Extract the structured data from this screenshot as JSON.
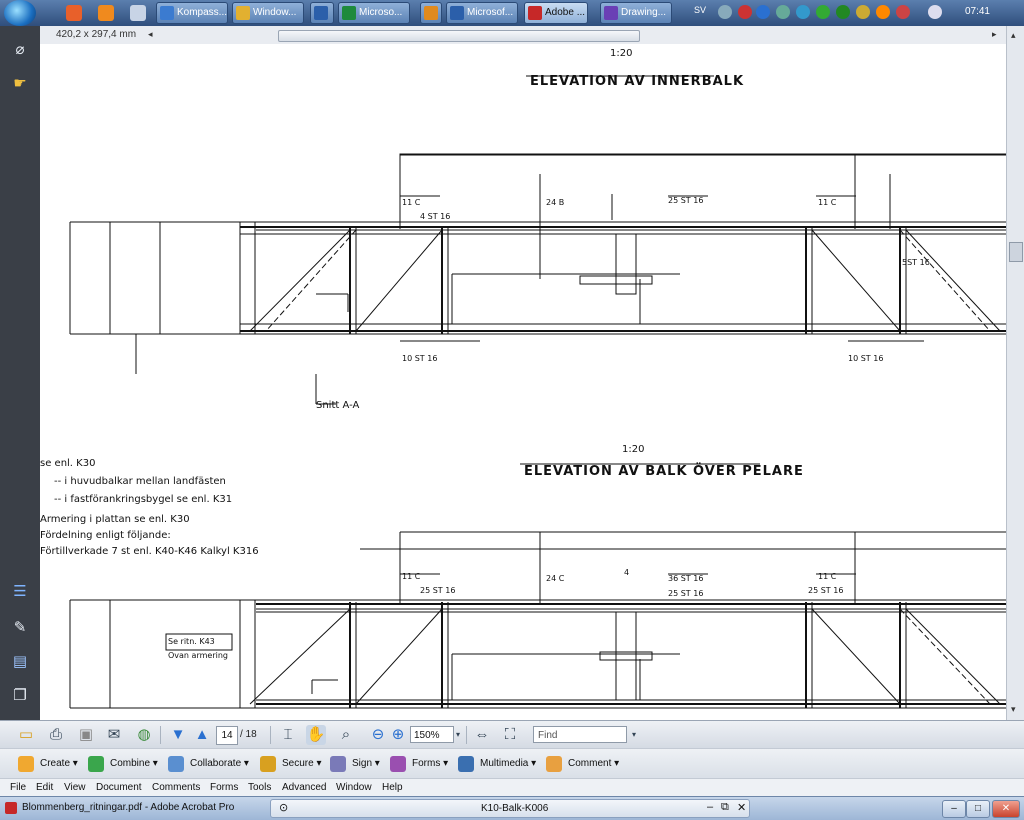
{
  "taskbar": {
    "tasks": [
      {
        "label": "Kompass...",
        "color": "#3b7bd0",
        "active": false
      },
      {
        "label": "Window...",
        "color": "#e2b030",
        "active": false
      },
      {
        "label": "",
        "color": "#2b5faa",
        "active": false
      },
      {
        "label": "Microso...",
        "color": "#1e8a3c",
        "active": false
      },
      {
        "label": "",
        "color": "#e08a1e",
        "active": false
      },
      {
        "label": "Microsof...",
        "color": "#2b5faa",
        "active": false
      },
      {
        "label": "Adobe ...",
        "color": "#c62828",
        "active": true
      },
      {
        "label": "Drawing...",
        "color": "#6a3fb5",
        "active": false
      }
    ],
    "language": "SV",
    "clock": "07:41"
  },
  "document": {
    "page_size": "420,2 x 297,4 mm",
    "title_top": "ELEVATION AV INNERBALK",
    "scale_top": "1:20",
    "title_bottom": "ELEVATION AV BALK ÖVER PELARE",
    "scale_bottom": "1:20",
    "label_section": "Snitt A-A",
    "labels": [
      "25 ST 16",
      "10 ST 16",
      "10 ST 16",
      "11 C",
      "11 C",
      "24 B",
      "36 ST 16",
      "25 ST 16",
      "24 C",
      "4 ST 16",
      "5ST 16",
      "11 C",
      "11 C",
      "25 ST 16",
      "25 ST 16",
      "4"
    ],
    "notes": [
      "Förtillverkade 7 st enl. K40-K46 Kalkyl K316",
      "Fördelning enligt följande:",
      "Armering i plattan se enl. K30",
      "-- i fastförankringsbygel se enl. K31",
      "-- i huvudbalkar mellan landfästen",
      "se enl. K30"
    ],
    "box_note_1": "Se ritn. K43",
    "box_note_2": "Ovan armering"
  },
  "toolbar1": {
    "page_current": "14",
    "page_total": "/ 18",
    "zoom": "150%",
    "find_placeholder": "Find"
  },
  "toolbar2": {
    "tools": [
      {
        "label": "Create",
        "color": "#f0a830"
      },
      {
        "label": "Combine",
        "color": "#3aa64c"
      },
      {
        "label": "Collaborate",
        "color": "#5a8fd0"
      },
      {
        "label": "Secure",
        "color": "#d8a020"
      },
      {
        "label": "Sign",
        "color": "#7a7ab8"
      },
      {
        "label": "Forms",
        "color": "#9a4fb0"
      },
      {
        "label": "Multimedia",
        "color": "#3a6fb0"
      },
      {
        "label": "Comment",
        "color": "#e8a040"
      }
    ]
  },
  "menubar": [
    "File",
    "Edit",
    "View",
    "Document",
    "Comments",
    "Forms",
    "Tools",
    "Advanced",
    "Window",
    "Help"
  ],
  "window": {
    "app_title": "Blommenberg_ritningar.pdf - Adobe Acrobat Pro",
    "doc_tab": "K10-Balk-K006"
  }
}
